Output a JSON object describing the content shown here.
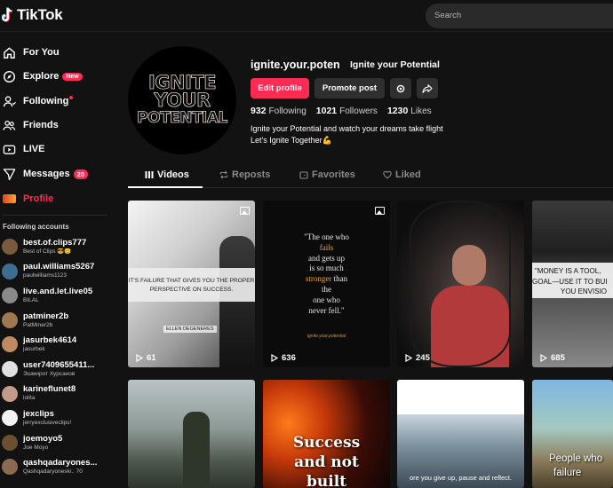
{
  "app": {
    "name": "TikTok"
  },
  "search": {
    "placeholder": "Search"
  },
  "nav": {
    "for_you": "For You",
    "explore": "Explore",
    "explore_badge": "New",
    "following": "Following",
    "friends": "Friends",
    "live": "LIVE",
    "messages": "Messages",
    "messages_count": "20",
    "profile": "Profile"
  },
  "following_accounts": {
    "title": "Following accounts",
    "items": [
      {
        "name": "best.of.clips777",
        "sub": "Best of Clips 😎😊",
        "color": "#7a5a3c"
      },
      {
        "name": "paul.williams5267",
        "sub": "paulwilliams1123",
        "color": "#3d6e8f"
      },
      {
        "name": "live.and.let.live05",
        "sub": "BILAL",
        "color": "#8a8a8a"
      },
      {
        "name": "patminer2b",
        "sub": "PatMiner2b",
        "color": "#a07850"
      },
      {
        "name": "jasurbek4614",
        "sub": "jasurbek",
        "color": "#c08a60"
      },
      {
        "name": "user7409655411...",
        "sub": "Эшмирот Хурсанов",
        "color": "#e0e0e0"
      },
      {
        "name": "karineflunet8",
        "sub": "lolita",
        "color": "#c49a8a"
      },
      {
        "name": "jexclips",
        "sub": "jerryexclusiveclips!",
        "color": "#f2f2f2"
      },
      {
        "name": "joemoyo5",
        "sub": "Joe Moyo",
        "color": "#6a5030"
      },
      {
        "name": "qashqadaryones...",
        "sub": "Qashqadaryoneski.. 70",
        "color": "#8c6a50"
      }
    ]
  },
  "profile": {
    "avatar_lines": [
      "IGNITE",
      "YOUR",
      "POTENTIAL"
    ],
    "username": "ignite.your.poten",
    "nickname": "Ignite your Potential",
    "edit_label": "Edit profile",
    "promote_label": "Promote post",
    "following_count": "932",
    "following_label": "Following",
    "followers_count": "1021",
    "followers_label": "Followers",
    "likes_count": "1230",
    "likes_label": "Likes",
    "bio_line1": "Ignite your Potential and watch your dreams take flight",
    "bio_line2": "Let's Ignite Together💪"
  },
  "tabs": {
    "videos": "Videos",
    "reposts": "Reposts",
    "favorites": "Favorites",
    "liked": "Liked"
  },
  "videos": [
    {
      "views": "61",
      "overlay": "IT'S FAILURE THAT GIVES YOU THE PROPER PERSPECTIVE ON SUCCESS.",
      "caption": "ELLEN DEGENERES"
    },
    {
      "views": "636",
      "quote_lines": [
        "\"The one who",
        "fails",
        "and gets up",
        "is so much",
        "stronger than",
        "the",
        "one who",
        "never fell.\""
      ],
      "signature": "ignite.your.potential"
    },
    {
      "views": "245"
    },
    {
      "views": "685",
      "overlay_lines": [
        "\"MONEY IS A TOOL,",
        "GOAL—USE IT TO BUI",
        "YOU ENVISIO"
      ]
    },
    {
      "views": ""
    },
    {
      "views": "",
      "overlay_lines": [
        "Success",
        "and not",
        "built"
      ]
    },
    {
      "views": "",
      "overlay": "ore you give up, pause and reflect."
    },
    {
      "views": "",
      "overlay_lines": [
        "People who",
        "failure"
      ]
    }
  ],
  "colors": {
    "accent": "#fe2c55",
    "background": "#121212"
  }
}
